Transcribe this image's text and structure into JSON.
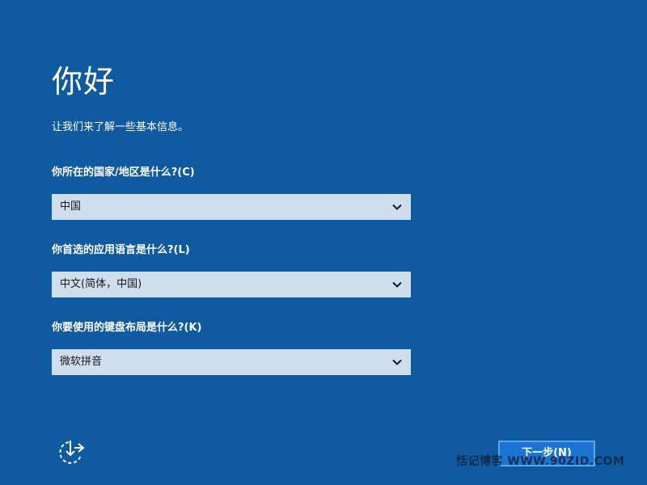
{
  "header": {
    "title": "你好",
    "subtitle": "让我们来了解一些基本信息。"
  },
  "fields": [
    {
      "label": "你所在的国家/地区是什么?(C)",
      "value": "中国"
    },
    {
      "label": "你首选的应用语言是什么?(L)",
      "value": "中文(简体，中国)"
    },
    {
      "label": "你要使用的键盘布局是什么?(K)",
      "value": "微软拼音"
    }
  ],
  "footer": {
    "accessibility_icon": "ease-of-access-icon",
    "next_label": "下一步(N)"
  },
  "watermark": "恬记博客 WWW.90ZID.COM",
  "colors": {
    "background": "#0f5aa0",
    "select_background": "#cfdeed",
    "button_background": "#1a75d2",
    "button_border": "#5aa7f0"
  }
}
